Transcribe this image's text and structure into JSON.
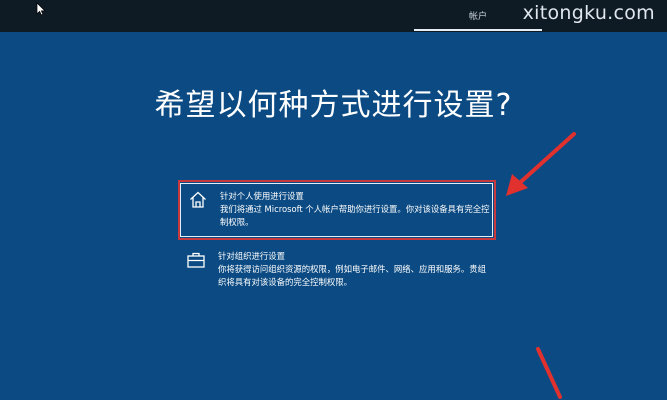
{
  "topbar": {
    "tab_label": "帐户"
  },
  "watermark": "xitongku.com",
  "page_title": "希望以何种方式进行设置?",
  "options": [
    {
      "title": "针对个人使用进行设置",
      "description": "我们将通过 Microsoft 个人帐户帮助你进行设置。你对该设备具有完全控制权限。",
      "icon": "home-icon"
    },
    {
      "title": "针对组织进行设置",
      "description": "你将获得访问组织资源的权限，例如电子邮件、网络、应用和服务。贵组织将具有对该设备的完全控制权限。",
      "icon": "briefcase-icon"
    }
  ],
  "colors": {
    "background": "#0b4a82",
    "topbar": "#0e1a24",
    "highlight_red": "#c8383c"
  }
}
